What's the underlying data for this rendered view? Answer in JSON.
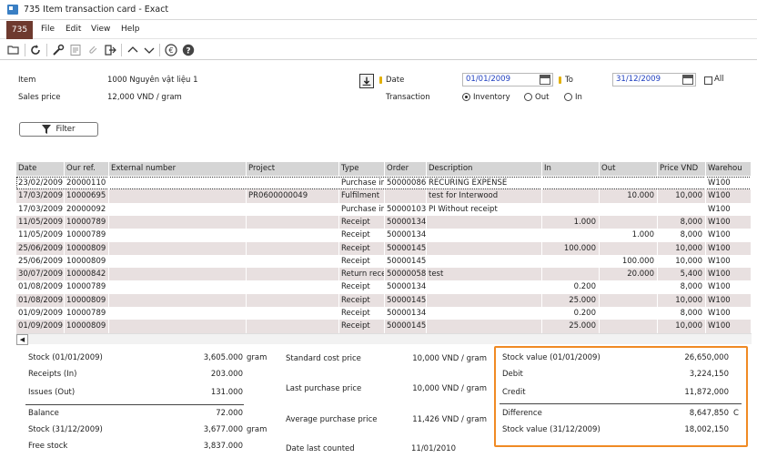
{
  "window": {
    "title": "735 Item transaction card - Exact"
  },
  "menu": {
    "badge": "735",
    "items": [
      "File",
      "Edit",
      "View",
      "Help"
    ]
  },
  "toolbar": {
    "icons": [
      "open-folder-icon",
      "refresh-icon",
      "wrench-icon",
      "note-icon",
      "paperclip-icon",
      "exit-icon",
      "up-arrow-icon",
      "down-arrow-icon",
      "euro-icon",
      "help-icon"
    ]
  },
  "header": {
    "item_label": "Item",
    "item_value": "1000 Nguyên vật liệu 1",
    "sales_price_label": "Sales price",
    "sales_price_value": "12,000 VND / gram",
    "date_label": "Date",
    "date_from": "01/01/2009",
    "to_label": "To",
    "date_to": "31/12/2009",
    "all_label": "All",
    "transaction_label": "Transaction",
    "radio_inventory": "Inventory",
    "radio_out": "Out",
    "radio_in": "In",
    "filter_label": "Filter"
  },
  "grid": {
    "columns": [
      "Date",
      "Our ref.",
      "External number",
      "Project",
      "Type",
      "Order",
      "Description",
      "In",
      "Out",
      "Price VND",
      "Warehou"
    ],
    "rows": [
      [
        "23/02/2009",
        "20000110",
        "",
        "",
        "Purchase in",
        "50000086",
        "RECURING EXPENSE",
        "",
        "",
        "",
        "W100"
      ],
      [
        "17/03/2009",
        "10000695",
        "",
        "PR0600000049",
        "Fulfilment",
        "",
        "test for Interwood",
        "",
        "10.000",
        "10,000",
        "W100"
      ],
      [
        "17/03/2009",
        "20000092",
        "",
        "",
        "Purchase in",
        "50000103",
        "PI Without receipt",
        "",
        "",
        "",
        "W100"
      ],
      [
        "11/05/2009",
        "10000789",
        "",
        "",
        "Receipt",
        "50000134",
        "",
        "1.000",
        "",
        "8,000",
        "W100"
      ],
      [
        "11/05/2009",
        "10000789",
        "",
        "",
        "Receipt",
        "50000134",
        "",
        "",
        "1.000",
        "8,000",
        "W100"
      ],
      [
        "25/06/2009",
        "10000809",
        "",
        "",
        "Receipt",
        "50000145",
        "",
        "100.000",
        "",
        "10,000",
        "W100"
      ],
      [
        "25/06/2009",
        "10000809",
        "",
        "",
        "Receipt",
        "50000145",
        "",
        "",
        "100.000",
        "10,000",
        "W100"
      ],
      [
        "30/07/2009",
        "10000842",
        "",
        "",
        "Return rece",
        "50000058",
        "test",
        "",
        "20.000",
        "5,400",
        "W100"
      ],
      [
        "01/08/2009",
        "10000789",
        "",
        "",
        "Receipt",
        "50000134",
        "",
        "0.200",
        "",
        "8,000",
        "W100"
      ],
      [
        "01/08/2009",
        "10000809",
        "",
        "",
        "Receipt",
        "50000145",
        "",
        "25.000",
        "",
        "10,000",
        "W100"
      ],
      [
        "01/09/2009",
        "10000789",
        "",
        "",
        "Receipt",
        "50000134",
        "",
        "0.200",
        "",
        "8,000",
        "W100"
      ],
      [
        "01/09/2009",
        "10000809",
        "",
        "",
        "Receipt",
        "50000145",
        "",
        "25.000",
        "",
        "10,000",
        "W100"
      ]
    ]
  },
  "summary": {
    "stock_label": "Stock (01/01/2009)",
    "stock_value": "3,605.000",
    "stock_unit": "gram",
    "receipts_label": "Receipts (In)",
    "receipts_value": "203.000",
    "issues_label": "Issues (Out)",
    "issues_value": "131.000",
    "balance_label": "Balance",
    "balance_value": "72.000",
    "stock_end_label": "Stock (31/12/2009)",
    "stock_end_value": "3,677.000",
    "stock_end_unit": "gram",
    "free_stock_label": "Free stock",
    "free_stock_value": "3,837.000",
    "std_cost_label": "Standard cost price",
    "std_cost_value": "10,000 VND / gram",
    "last_purchase_label": "Last purchase price",
    "last_purchase_value": "10,000 VND / gram",
    "avg_purchase_label": "Average purchase price",
    "avg_purchase_value": "11,426 VND / gram",
    "date_last_counted_label": "Date last counted",
    "date_last_counted_value": "11/01/2010"
  },
  "valuation": {
    "stock_value_label": "Stock value (01/01/2009)",
    "stock_value": "26,650,000",
    "debit_label": "Debit",
    "debit_value": "3,224,150",
    "credit_label": "Credit",
    "credit_value": "11,872,000",
    "difference_label": "Difference",
    "difference_value": "8,647,850",
    "difference_suffix": "C",
    "stock_value_end_label": "Stock value (31/12/2009)",
    "stock_value_end": "18,002,150"
  },
  "colors": {
    "highlight_box": "#f08a24",
    "badge_bg": "#6e3a2f",
    "row_alt": "#e8e0e0",
    "date_text": "#1f3fbf"
  }
}
